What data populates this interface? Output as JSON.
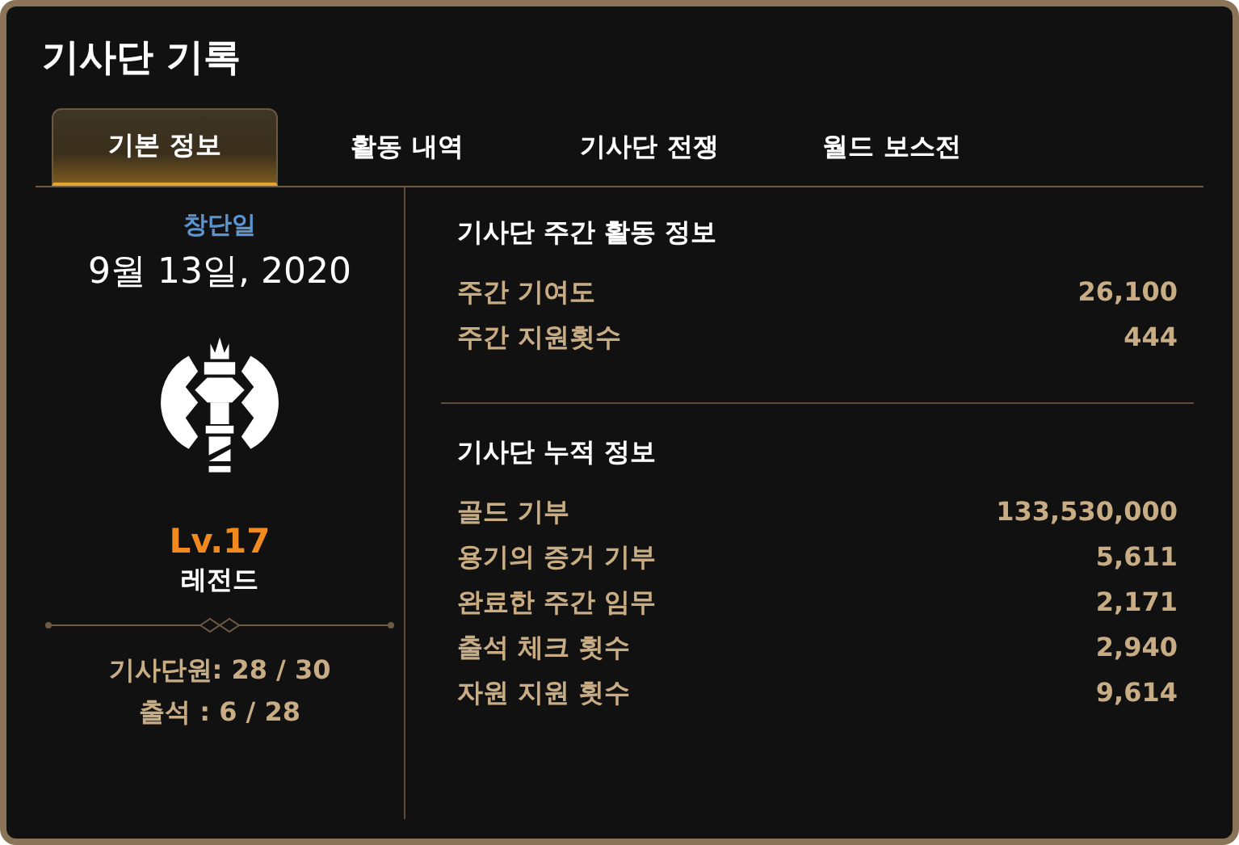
{
  "window": {
    "title": "기사단 기록"
  },
  "tabs": [
    {
      "label": "기본 정보",
      "selected": true
    },
    {
      "label": "활동 내역",
      "selected": false
    },
    {
      "label": "기사단 전쟁",
      "selected": false
    },
    {
      "label": "월드 보스전",
      "selected": false
    }
  ],
  "profile": {
    "founded_label": "창단일",
    "founded_date": "9월 13일, 2020",
    "level": "Lv.17",
    "rank": "레전드",
    "members": "기사단원: 28 / 30",
    "attendance": "출석 : 6 / 28"
  },
  "sections": [
    {
      "title": "기사단 주간 활동 정보",
      "rows": [
        {
          "label": "주간 기여도",
          "value": "26,100"
        },
        {
          "label": "주간 지원횟수",
          "value": "444"
        }
      ]
    },
    {
      "title": "기사단 누적 정보",
      "rows": [
        {
          "label": "골드 기부",
          "value": "133,530,000"
        },
        {
          "label": "용기의 증거 기부",
          "value": "5,611"
        },
        {
          "label": "완료한 주간 임무",
          "value": "2,171"
        },
        {
          "label": "출석 체크 횟수",
          "value": "2,940"
        },
        {
          "label": "자원 지원 횟수",
          "value": "9,614"
        }
      ]
    }
  ]
}
